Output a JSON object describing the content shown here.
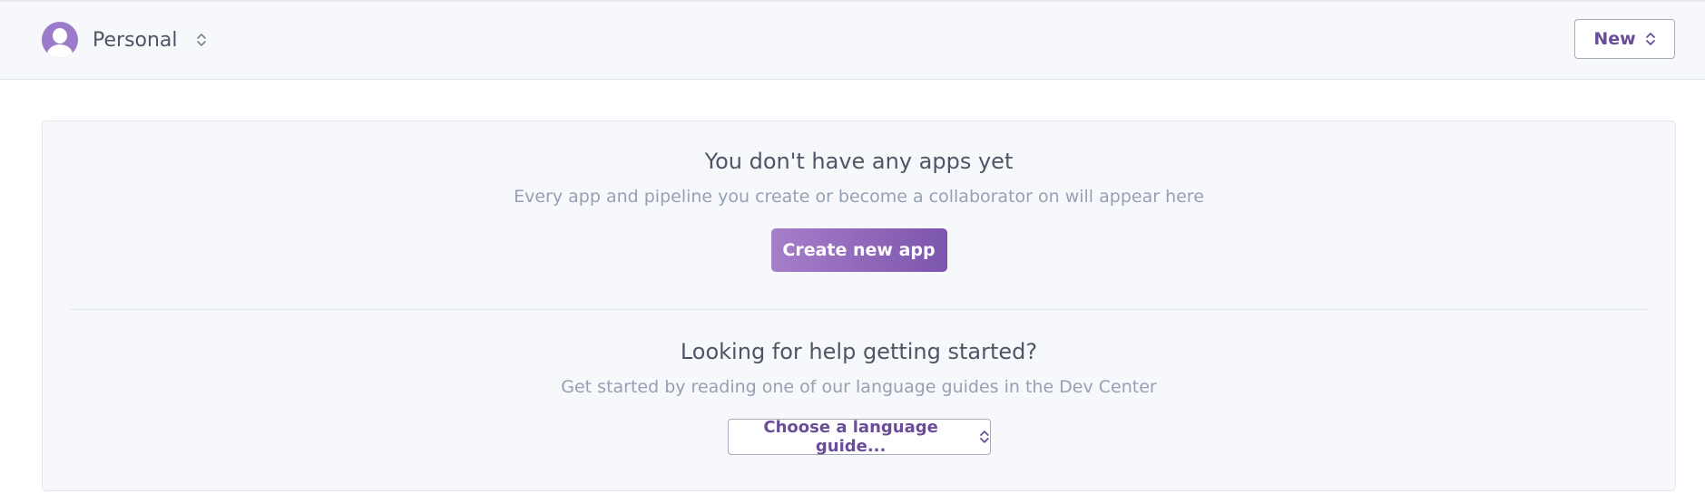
{
  "header": {
    "account_label": "Personal",
    "account_avatar_icon": "user-avatar-icon",
    "switcher_icon": "chevron-up-down-icon",
    "new_button_label": "New"
  },
  "empty_state": {
    "heading": "You don't have any apps yet",
    "subtext": "Every app and pipeline you create or become a collaborator on will appear here",
    "create_button_label": "Create new app"
  },
  "help": {
    "heading": "Looking for help getting started?",
    "subtext": "Get started by reading one of our language guides in the Dev Center",
    "select_value": "Choose a language guide..."
  },
  "colors": {
    "accent": "#79589f",
    "panel_bg": "#f7f8fb",
    "heading_text": "#4f5565",
    "muted_text": "#96a0b3"
  }
}
